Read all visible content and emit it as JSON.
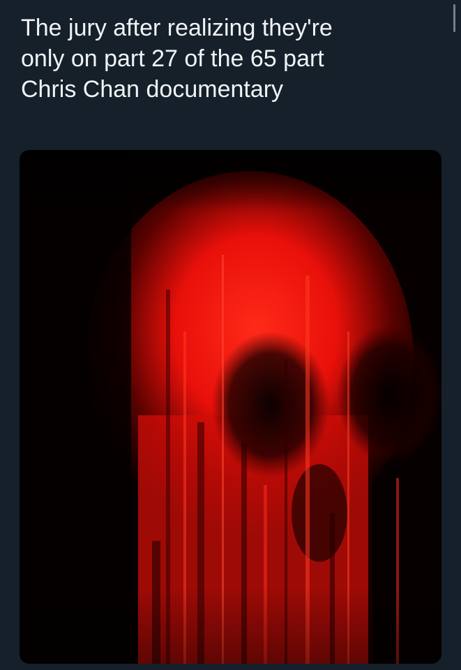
{
  "tweet": {
    "text": "The jury after realizing they're\nonly on part 27 of the 65 part\nChris Chan documentary"
  },
  "media": {
    "description_icon": "red-glitch-skull-image"
  },
  "colors": {
    "background": "#15202b",
    "text": "#f1f3f5",
    "accent_red": "#ff1a10"
  }
}
